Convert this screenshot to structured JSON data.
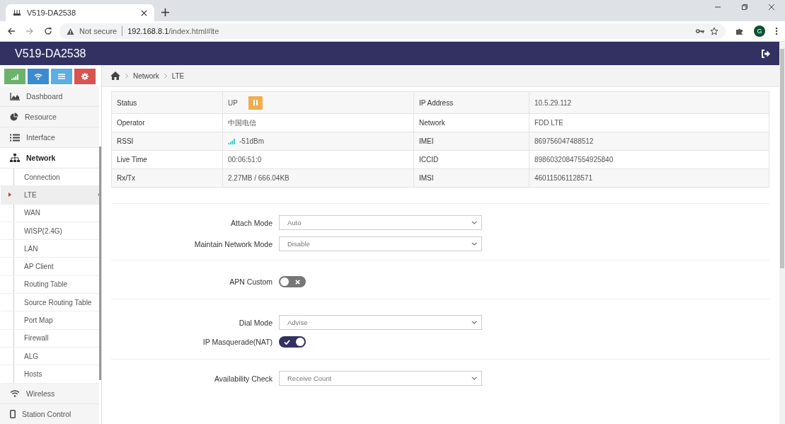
{
  "browser": {
    "tab_title": "V519-DA2538",
    "url_warning": "Not secure",
    "url_host": "192.168.8.1",
    "url_path": "/index.html#lte",
    "profile_letter": "G"
  },
  "header": {
    "title": "V519-DA2538"
  },
  "quick_buttons": [
    {
      "kind": "signal",
      "color": "#6cb26c"
    },
    {
      "kind": "wifi",
      "color": "#3c8ad0"
    },
    {
      "kind": "list",
      "color": "#5cade0"
    },
    {
      "kind": "settings",
      "color": "#d9534f"
    }
  ],
  "sidebar": {
    "items": [
      {
        "label": "Dashboard",
        "expanded": false
      },
      {
        "label": "Resource",
        "expanded": false
      },
      {
        "label": "Interface",
        "expanded": false
      },
      {
        "label": "Network",
        "expanded": true,
        "children": [
          {
            "label": "Connection",
            "selected": false
          },
          {
            "label": "LTE",
            "selected": true
          },
          {
            "label": "WAN",
            "selected": false
          },
          {
            "label": "WISP(2.4G)",
            "selected": false
          },
          {
            "label": "LAN",
            "selected": false
          },
          {
            "label": "AP Client",
            "selected": false
          },
          {
            "label": "Routing Table",
            "selected": false
          },
          {
            "label": "Source Routing Table",
            "selected": false
          },
          {
            "label": "Port Map",
            "selected": false
          },
          {
            "label": "Firewall",
            "selected": false
          },
          {
            "label": "ALG",
            "selected": false
          },
          {
            "label": "Hosts",
            "selected": false
          }
        ]
      },
      {
        "label": "Wireless",
        "expanded": false
      },
      {
        "label": "Station Control",
        "expanded": false
      }
    ]
  },
  "breadcrumb": [
    "Network",
    "LTE"
  ],
  "status_table": {
    "rows": [
      {
        "label": "Status",
        "value": "UP",
        "label_2": "IP Address",
        "value_2": "10.5.29.112"
      },
      {
        "label": "Operator",
        "value": "中国电信",
        "label_2": "Network",
        "value_2": "FDD LTE"
      },
      {
        "label": "RSSI",
        "value": "-51dBm",
        "label_2": "IMEI",
        "value_2": "869756047488512"
      },
      {
        "label": "Live Time",
        "value": "00:06:51:0",
        "label_2": "ICCID",
        "value_2": "89860320847554925840"
      },
      {
        "label": "Rx/Tx",
        "value": "2.27MB / 666.04KB",
        "label_2": "IMSI",
        "value_2": "460115061128571"
      }
    ]
  },
  "form_sections": [
    {
      "fields": [
        {
          "kind": "select",
          "label": "Attach Mode",
          "value": "Auto"
        },
        {
          "kind": "select",
          "label": "Maintain Network Mode",
          "value": "Disable"
        }
      ]
    },
    {
      "fields": [
        {
          "kind": "toggle",
          "label": "APN Custom",
          "on": false
        }
      ]
    },
    {
      "fields": [
        {
          "kind": "select",
          "label": "Dial Mode",
          "value": "Advise"
        },
        {
          "kind": "toggle",
          "label": "IP Masquerade(NAT)",
          "on": true
        }
      ]
    },
    {
      "fields": [
        {
          "kind": "select",
          "label": "Availability Check",
          "value": "Receive Count"
        }
      ]
    }
  ]
}
